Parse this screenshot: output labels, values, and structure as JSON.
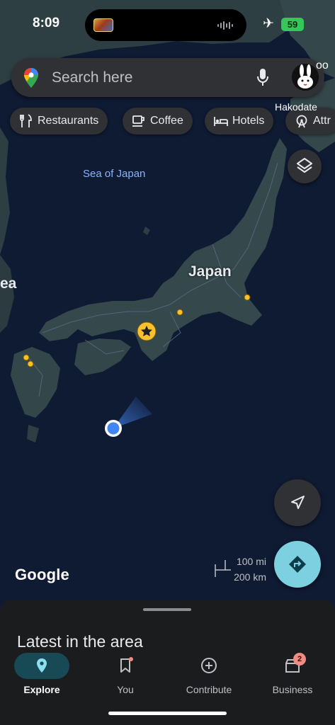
{
  "status_bar": {
    "time": "8:09",
    "battery": "59",
    "airplane_icon": "airplane-icon"
  },
  "search": {
    "placeholder": "Search here"
  },
  "chips": [
    {
      "label": "Restaurants",
      "icon": "fork-knife-icon"
    },
    {
      "label": "Coffee",
      "icon": "coffee-cup-icon"
    },
    {
      "label": "Hotels",
      "icon": "bed-icon"
    },
    {
      "label": "Attr",
      "icon": "ferris-wheel-icon"
    }
  ],
  "map": {
    "sea_label": "Sea of Japan",
    "country_label": "Japan",
    "city_label": "Hakodate",
    "edge_label_left": "ea",
    "edge_label_top": "oo",
    "attribution": "Google",
    "scale": {
      "miles": "100 mi",
      "kilometers": "200 km"
    }
  },
  "sheet": {
    "title": "Latest in the area"
  },
  "bottom_nav": {
    "items": [
      {
        "label": "Explore",
        "icon": "explore-pin-icon",
        "active": true
      },
      {
        "label": "You",
        "icon": "bookmark-icon",
        "active": false
      },
      {
        "label": "Contribute",
        "icon": "add-circle-icon",
        "active": false
      },
      {
        "label": "Business",
        "icon": "storefront-icon",
        "active": false,
        "badge": "2"
      }
    ]
  },
  "colors": {
    "accent": "#8ab4f8",
    "directions": "#7dd0e0",
    "location": "#4285f4",
    "pin": "#fbc02d"
  }
}
